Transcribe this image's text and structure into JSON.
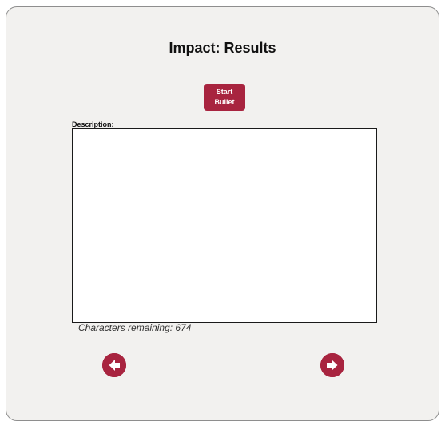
{
  "header": {
    "title": "Impact: Results"
  },
  "toolbar": {
    "start_bullet_line1": "Start",
    "start_bullet_line2": "Bullet"
  },
  "description": {
    "label": "Description:",
    "value": "",
    "characters_remaining_label": "Characters remaining:",
    "characters_remaining": 674
  },
  "navigation": {
    "prev_icon": "arrow-left-circle-icon",
    "next_icon": "arrow-right-circle-icon"
  },
  "colors": {
    "accent": "#a8243f",
    "panel_background": "#f2f1ef"
  }
}
